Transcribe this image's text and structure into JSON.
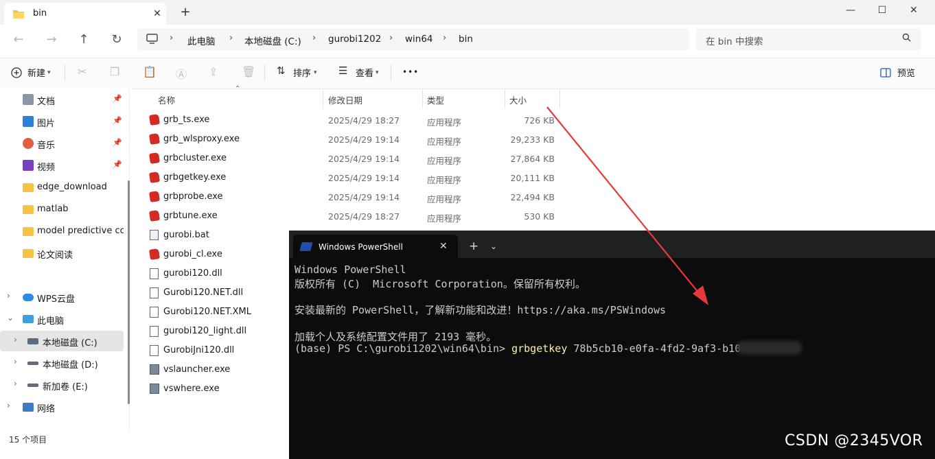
{
  "window": {
    "tab_title": "bin",
    "tab_close": "✕",
    "new_tab": "+",
    "minimize": "—",
    "maximize": "☐",
    "close": "✕"
  },
  "nav": {
    "back": "←",
    "forward": "→",
    "up": "↑",
    "refresh": "↻"
  },
  "breadcrumb": [
    "此电脑",
    "本地磁盘 (C:)",
    "gurobi1202",
    "win64",
    "bin"
  ],
  "breadcrumb_sep": "›",
  "search": {
    "placeholder": "在 bin 中搜索"
  },
  "toolbar": {
    "new_label": "新建",
    "sort_label": "排序",
    "view_label": "查看",
    "more": "•••",
    "preview_label": "预览"
  },
  "sidebar": {
    "quick": [
      {
        "label": "文档"
      },
      {
        "label": "图片"
      },
      {
        "label": "音乐"
      },
      {
        "label": "视频"
      },
      {
        "label": "edge_download"
      },
      {
        "label": "matlab"
      },
      {
        "label": "model predictive control"
      },
      {
        "label": "论文阅读"
      }
    ],
    "tree": [
      {
        "label": "WPS云盘"
      },
      {
        "label": "此电脑"
      },
      {
        "label": "本地磁盘 (C:)"
      },
      {
        "label": "本地磁盘 (D:)"
      },
      {
        "label": "新加卷 (E:)"
      },
      {
        "label": "网络"
      }
    ]
  },
  "status": {
    "count": "15 个项目"
  },
  "columns": {
    "name": "名称",
    "date": "修改日期",
    "type": "类型",
    "size": "大小"
  },
  "files": [
    {
      "name": "grb_ts.exe",
      "date": "2025/4/29 18:27",
      "type": "应用程序",
      "size": "726 KB",
      "icon": "red-exe-icon"
    },
    {
      "name": "grb_wlsproxy.exe",
      "date": "2025/4/29 19:14",
      "type": "应用程序",
      "size": "29,233 KB",
      "icon": "red-exe-icon"
    },
    {
      "name": "grbcluster.exe",
      "date": "2025/4/29 19:14",
      "type": "应用程序",
      "size": "27,864 KB",
      "icon": "red-exe-icon"
    },
    {
      "name": "grbgetkey.exe",
      "date": "2025/4/29 19:14",
      "type": "应用程序",
      "size": "20,111 KB",
      "icon": "red-exe-icon"
    },
    {
      "name": "grbprobe.exe",
      "date": "2025/4/29 19:14",
      "type": "应用程序",
      "size": "22,494 KB",
      "icon": "red-exe-icon"
    },
    {
      "name": "grbtune.exe",
      "date": "2025/4/29 18:27",
      "type": "应用程序",
      "size": "530 KB",
      "icon": "red-exe-icon"
    },
    {
      "name": "gurobi.bat",
      "date": "",
      "type": "",
      "size": "",
      "icon": "bat-icon"
    },
    {
      "name": "gurobi_cl.exe",
      "date": "",
      "type": "",
      "size": "",
      "icon": "red-exe-icon"
    },
    {
      "name": "gurobi120.dll",
      "date": "",
      "type": "",
      "size": "",
      "icon": "dll-icon"
    },
    {
      "name": "Gurobi120.NET.dll",
      "date": "",
      "type": "",
      "size": "",
      "icon": "dll-icon"
    },
    {
      "name": "Gurobi120.NET.XML",
      "date": "",
      "type": "",
      "size": "",
      "icon": "doc-icon"
    },
    {
      "name": "gurobi120_light.dll",
      "date": "",
      "type": "",
      "size": "",
      "icon": "dll-icon"
    },
    {
      "name": "GurobiJni120.dll",
      "date": "",
      "type": "",
      "size": "",
      "icon": "dll-icon"
    },
    {
      "name": "vslauncher.exe",
      "date": "",
      "type": "",
      "size": "",
      "icon": "app-exe-icon"
    },
    {
      "name": "vswhere.exe",
      "date": "",
      "type": "",
      "size": "",
      "icon": "app-exe-icon"
    }
  ],
  "powershell": {
    "tab_title": "Windows PowerShell",
    "close": "✕",
    "plus": "+",
    "dropdown": "⌄",
    "lines": [
      "Windows PowerShell",
      "版权所有 (C)  Microsoft Corporation。保留所有权利。",
      "",
      "安装最新的 PowerShell，了解新功能和改进！https://aka.ms/PSWindows",
      "",
      "加载个人及系统配置文件用了 2193 毫秒。"
    ],
    "prompt": "(base) PS C:\\gurobi1202\\win64\\bin> ",
    "command": "grbgetkey",
    "argument": " 78b5cb10-e0fa-4fd2-9af3-b10"
  },
  "watermark": "CSDN @2345VOR",
  "colors": {
    "annotation_arrow": "#e8393a",
    "ps_command": "#f9f1a5",
    "ps_background": "#0c0c0c"
  }
}
